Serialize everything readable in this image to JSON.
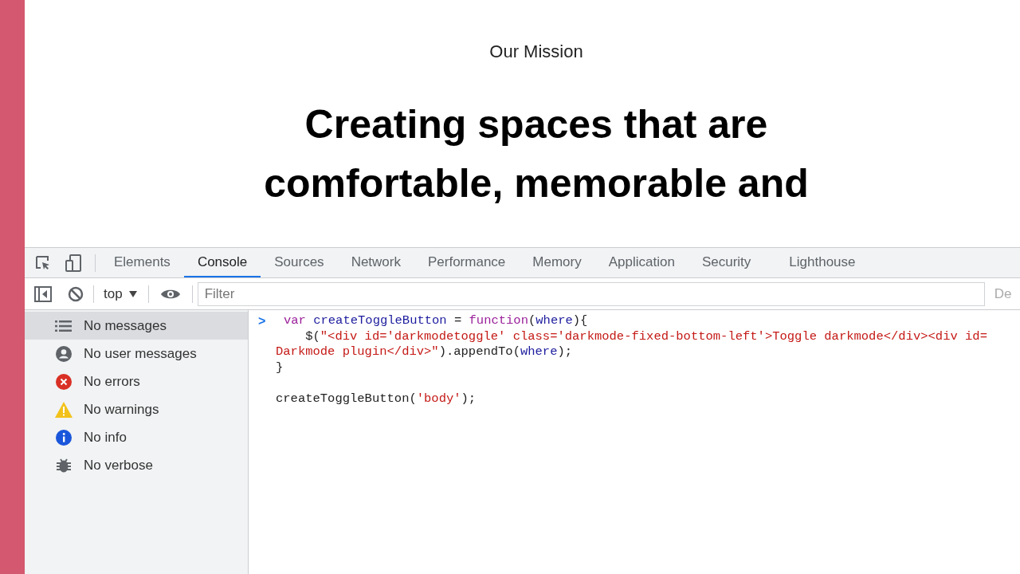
{
  "page": {
    "eyebrow": "Our Mission",
    "headline_lines": [
      "Creating spaces that are",
      "comfortable, memorable and"
    ]
  },
  "devtools": {
    "tabs": [
      {
        "label": "Elements",
        "selected": false
      },
      {
        "label": "Console",
        "selected": true
      },
      {
        "label": "Sources",
        "selected": false
      },
      {
        "label": "Network",
        "selected": false
      },
      {
        "label": "Performance",
        "selected": false
      },
      {
        "label": "Memory",
        "selected": false
      },
      {
        "label": "Application",
        "selected": false
      },
      {
        "label": "Security",
        "selected": false
      },
      {
        "label": "Lighthouse",
        "selected": false
      }
    ],
    "toolbar": {
      "context": "top",
      "filter_placeholder": "Filter",
      "levels_cut": "De"
    },
    "sidebar": [
      {
        "kind": "list",
        "label": "No messages",
        "selected": true
      },
      {
        "kind": "user",
        "label": "No user messages",
        "selected": false
      },
      {
        "kind": "error",
        "label": "No errors",
        "selected": false
      },
      {
        "kind": "warning",
        "label": "No warnings",
        "selected": false
      },
      {
        "kind": "info",
        "label": "No info",
        "selected": false
      },
      {
        "kind": "verbose",
        "label": "No verbose",
        "selected": false
      }
    ],
    "console": {
      "prompt": ">",
      "lines": [
        [
          {
            "kind": "keyword",
            "text": "var "
          },
          {
            "kind": "name",
            "text": "createToggleButton"
          },
          {
            "kind": "plain",
            "text": " = "
          },
          {
            "kind": "keyword",
            "text": "function"
          },
          {
            "kind": "plain",
            "text": "("
          },
          {
            "kind": "name",
            "text": "where"
          },
          {
            "kind": "plain",
            "text": "){"
          }
        ],
        [
          {
            "kind": "plain",
            "text": "    $("
          },
          {
            "kind": "string",
            "text": "\"<div id='darkmodetoggle' class='darkmode-fixed-bottom-left'>Toggle darkmode</div><div id="
          }
        ],
        [
          {
            "kind": "string",
            "text": "Darkmode plugin</div>\""
          },
          {
            "kind": "plain",
            "text": ").appendTo("
          },
          {
            "kind": "name",
            "text": "where"
          },
          {
            "kind": "plain",
            "text": ");"
          }
        ],
        [
          {
            "kind": "plain",
            "text": "}"
          }
        ],
        [
          {
            "kind": "spacer"
          },
          {
            "kind": "plain",
            "text": "createToggleButton("
          },
          {
            "kind": "string",
            "text": "'body'"
          },
          {
            "kind": "plain",
            "text": ");"
          }
        ]
      ]
    }
  }
}
